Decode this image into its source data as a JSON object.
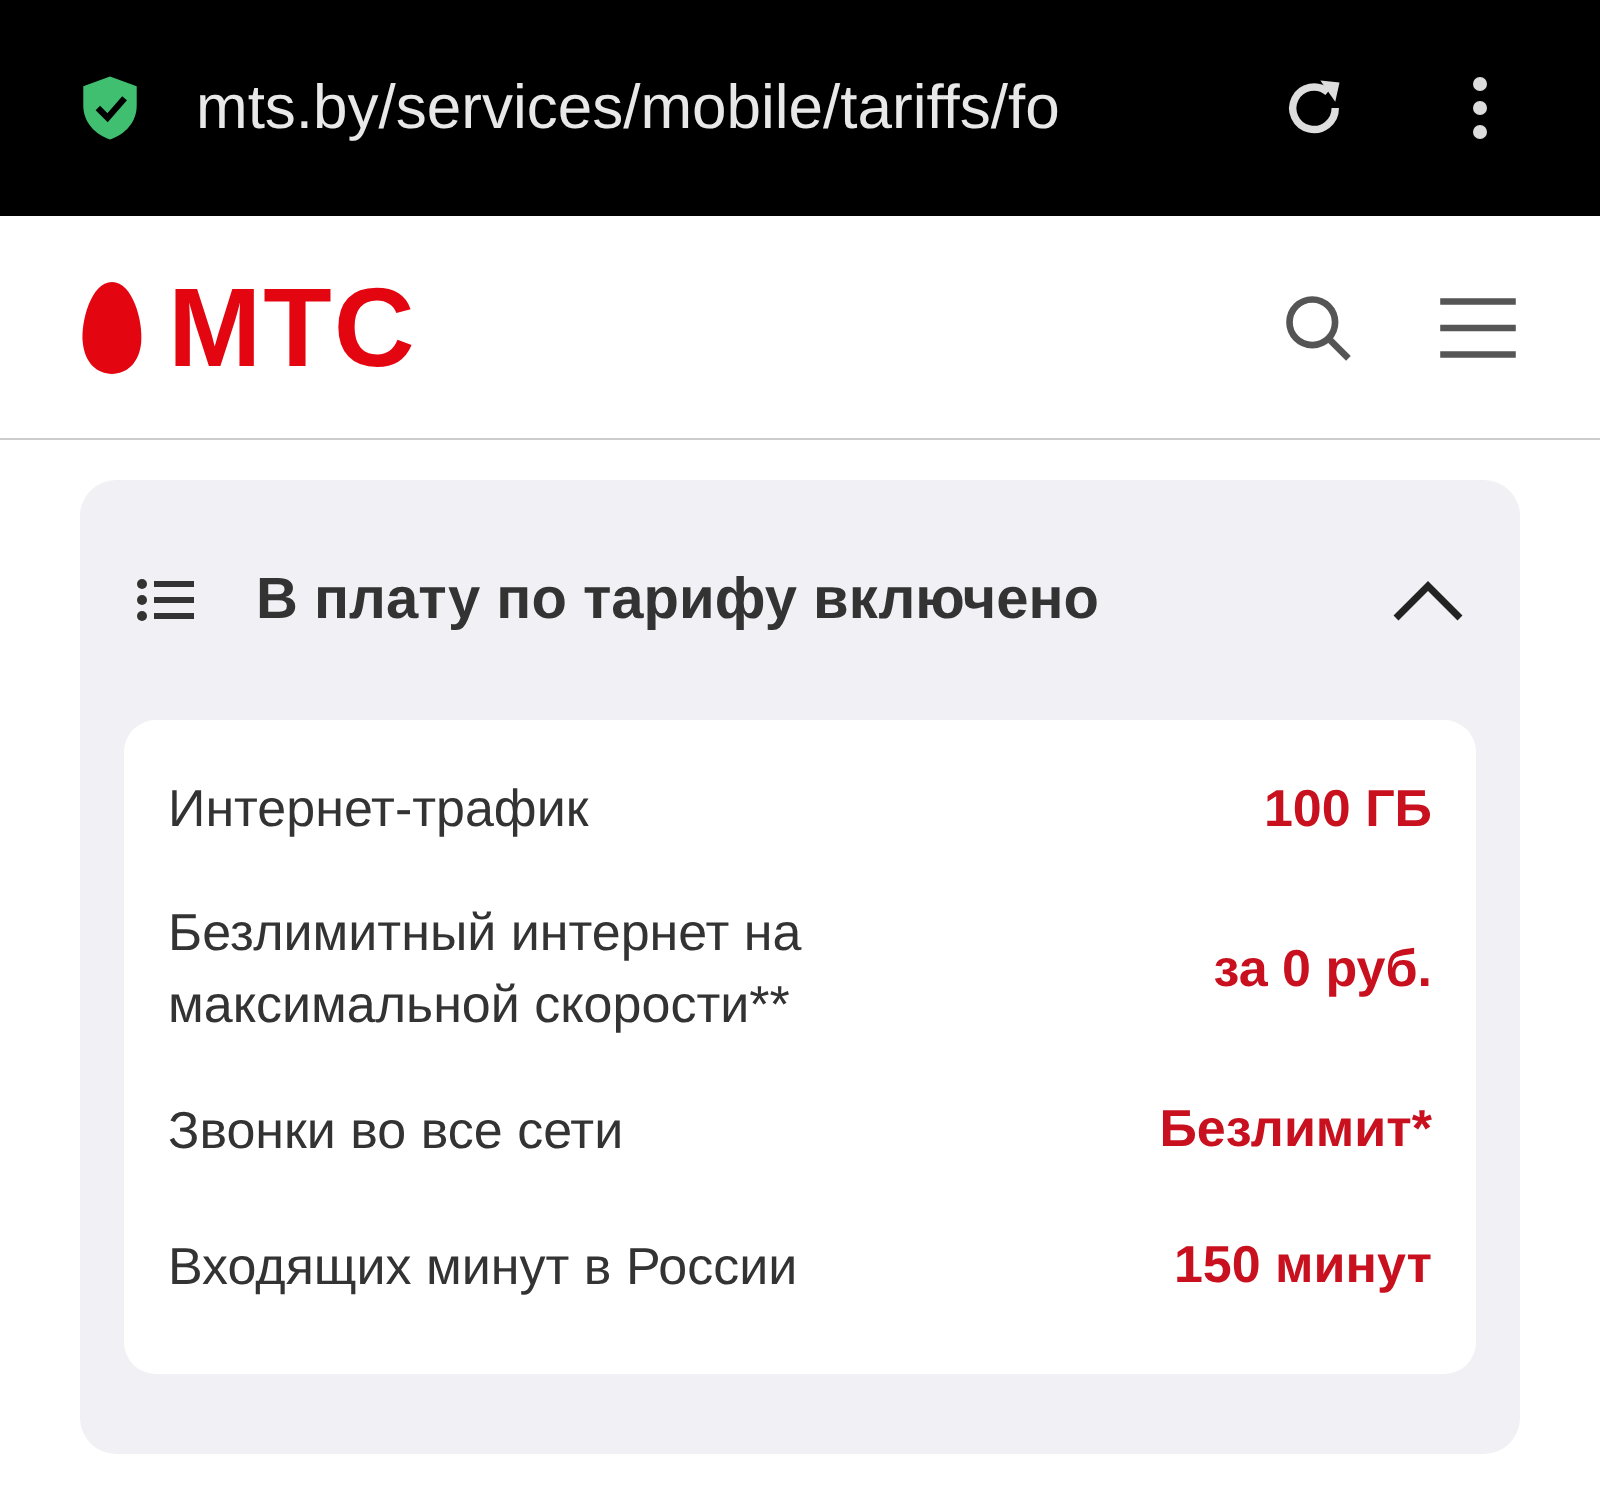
{
  "browser": {
    "url": "mts.by/services/mobile/tariffs/fo"
  },
  "header": {
    "logo": "МТС"
  },
  "section": {
    "title": "В плату по тарифу включено",
    "expanded": true,
    "rows": [
      {
        "label": "Интернет-трафик",
        "value": "100 ГБ"
      },
      {
        "label": "Безлимитный интернет на максимальной скорости**",
        "value": "за 0 руб."
      },
      {
        "label": "Звонки во все сети",
        "value": "Безлимит*"
      },
      {
        "label": "Входящих минут в России",
        "value": "150 минут"
      }
    ]
  }
}
